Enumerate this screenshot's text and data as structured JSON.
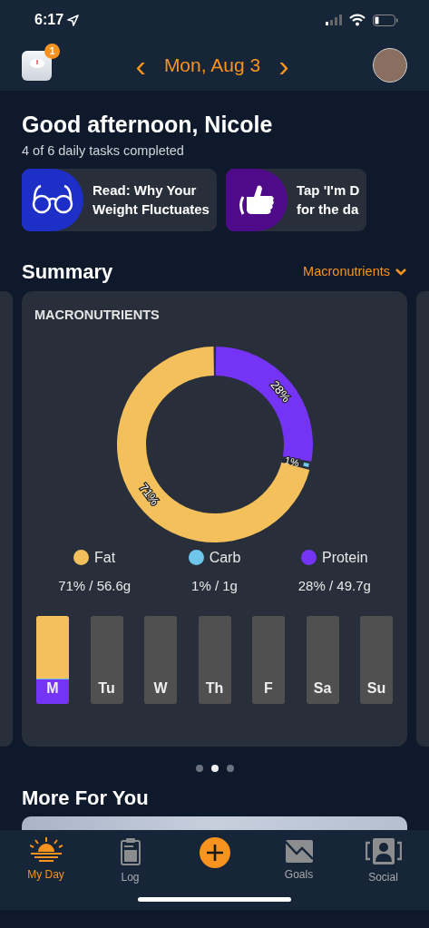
{
  "status_bar": {
    "time": "6:17"
  },
  "header": {
    "date": "Mon, Aug 3",
    "prev": "‹",
    "next": "›",
    "notification_count": "1"
  },
  "greeting": {
    "title": "Good afternoon, Nicole",
    "subtitle": "4 of 6 daily tasks completed"
  },
  "tasks": [
    {
      "kind": "read",
      "lines": [
        "Read: Why Your",
        "Weight Fluctuates"
      ],
      "color": "#1d2fc7"
    },
    {
      "kind": "thumb",
      "lines": [
        "Tap 'I'm D",
        "for the da"
      ],
      "color": "#4f0a8a"
    }
  ],
  "summary": {
    "title": "Summary",
    "dropdown": "Macronutrients"
  },
  "macro_card": {
    "title": "MACRONUTRIENTS",
    "chart_data": {
      "type": "donut",
      "categories": [
        "Fat",
        "Carb",
        "Protein"
      ],
      "series": [
        {
          "values": [
            71,
            1,
            28
          ]
        }
      ],
      "colors": [
        "#f4c05c",
        "#6ec6ea",
        "#7433f5"
      ],
      "value_labels": [
        "71%",
        "1%",
        "28%"
      ]
    },
    "legend_values": [
      "71% / 56.6g",
      "1% / 1g",
      "28% / 49.7g"
    ],
    "days": [
      {
        "label": "M",
        "segments": [
          {
            "color": "#f4c05c",
            "level": 0.71
          },
          {
            "color": "#6ec6ea",
            "level": 0.01
          },
          {
            "color": "#7433f5",
            "level": 0.28
          }
        ]
      },
      {
        "label": "Tu"
      },
      {
        "label": "W"
      },
      {
        "label": "Th"
      },
      {
        "label": "F"
      },
      {
        "label": "Sa"
      },
      {
        "label": "Su"
      }
    ]
  },
  "pager": [
    {
      "selected": false
    },
    {
      "selected": true
    },
    {
      "selected": false
    }
  ],
  "more": {
    "title": "More For You"
  },
  "tab_bar": [
    {
      "kind": "sun",
      "label": "My Day",
      "selected": true
    },
    {
      "kind": "clipboard",
      "label": "Log",
      "selected": false
    },
    {
      "kind": "add"
    },
    {
      "kind": "goals",
      "label": "Goals",
      "selected": false
    },
    {
      "kind": "social",
      "label": "Social",
      "selected": false
    }
  ]
}
